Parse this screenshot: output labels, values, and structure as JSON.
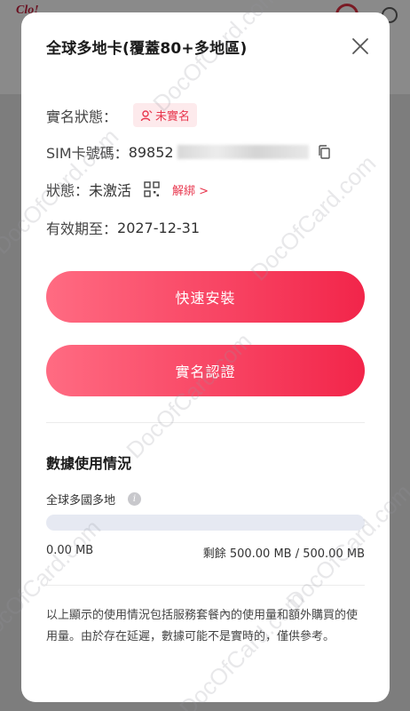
{
  "background": {
    "logo": "Clo!"
  },
  "modal": {
    "title": "全球多地卡(覆蓋80+多地區)",
    "realname": {
      "label": "實名狀態：",
      "status": "未實名"
    },
    "sim": {
      "label": "SIM卡號碼：",
      "number_prefix": "89852"
    },
    "state": {
      "label": "狀態：",
      "value": "未激活",
      "unbind": "解綁 >"
    },
    "expiry": {
      "label": "有效期至：",
      "date": "2027-12-31"
    },
    "buttons": {
      "install": "快速安裝",
      "verify": "實名認證"
    },
    "usage": {
      "section_title": "數據使用情況",
      "plan_name": "全球多國多地",
      "used_fraction": 0,
      "used": "0.00 MB",
      "remaining": "剩餘 500.00 MB / 500.00 MB"
    },
    "note": "以上顯示的使用情況包括服務套餐內的使用量和額外購買的使用量。由於存在延遲，數據可能不是實時的，僅供參考。"
  },
  "watermark": "DocOfCard.com",
  "colors": {
    "accent": "#f2254a",
    "badge_bg": "#fdeaec",
    "track": "#e6e9f2"
  }
}
